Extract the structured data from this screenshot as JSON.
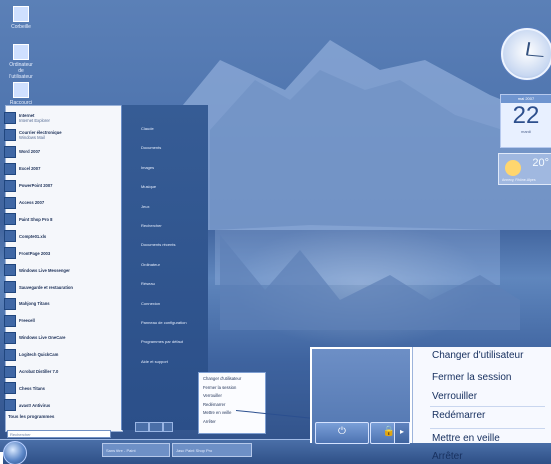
{
  "desktop": {
    "icons": [
      {
        "name": "Corbeille"
      },
      {
        "name": "Ordinateur de l'utilisateur"
      },
      {
        "name": "Raccourci"
      }
    ]
  },
  "start_menu": {
    "left_items": [
      {
        "label": "Internet",
        "sub": "Internet Explorer"
      },
      {
        "label": "Courrier électronique",
        "sub": "Windows Mail"
      },
      {
        "label": "Word 2007"
      },
      {
        "label": "Excel 2007"
      },
      {
        "label": "PowerPoint 2007"
      },
      {
        "label": "Access 2007"
      },
      {
        "label": "Paint Shop Pro 8"
      },
      {
        "label": "Compte01.xls"
      },
      {
        "label": "FrontPage 2003"
      },
      {
        "label": "Windows Live Messenger"
      },
      {
        "label": "Sauvegarde et restauration"
      },
      {
        "label": "Mahjong Titans"
      },
      {
        "label": "Freecell"
      },
      {
        "label": "Windows Live OneCare"
      },
      {
        "label": "Logitech QuickCam"
      },
      {
        "label": "Acrobat Distiller 7.0"
      },
      {
        "label": "Chess Titans"
      },
      {
        "label": "avast! Antivirus"
      }
    ],
    "all_programs": "Tous les programmes",
    "search_placeholder": "Rechercher",
    "right_items": [
      "Claude",
      "Documents",
      "Images",
      "Musique",
      "Jeux",
      "Rechercher",
      "Documents récents",
      "Ordinateur",
      "Réseau",
      "Connexion",
      "Panneau de configuration",
      "Programmes par défaut",
      "Aide et support"
    ],
    "submenu_small": [
      "Changer d'utilisateur",
      "Fermer la session",
      "Verrouiller",
      "Redémarrer",
      "Mettre en veille",
      "Arrêter"
    ]
  },
  "gadgets": {
    "calendar": {
      "month": "mai 2007",
      "day": "22",
      "weekday": "mardi"
    },
    "weather": {
      "temp": "20°",
      "city": "Annecy, Rhône-Alpes"
    }
  },
  "taskbar": {
    "buttons": [
      "Sans titre - Paint",
      "Jasc Paint Shop Pro"
    ]
  },
  "zoom_menu": {
    "items": [
      "Changer d'utilisateur",
      "Fermer la session",
      "Verrouiller",
      "Redémarrer",
      "Mettre en veille",
      "Arrêter"
    ]
  },
  "colors": {
    "accent": "#2b4f8f",
    "menu_bg": "#f7f9ff",
    "desktop_blue": "#4e74ae"
  }
}
